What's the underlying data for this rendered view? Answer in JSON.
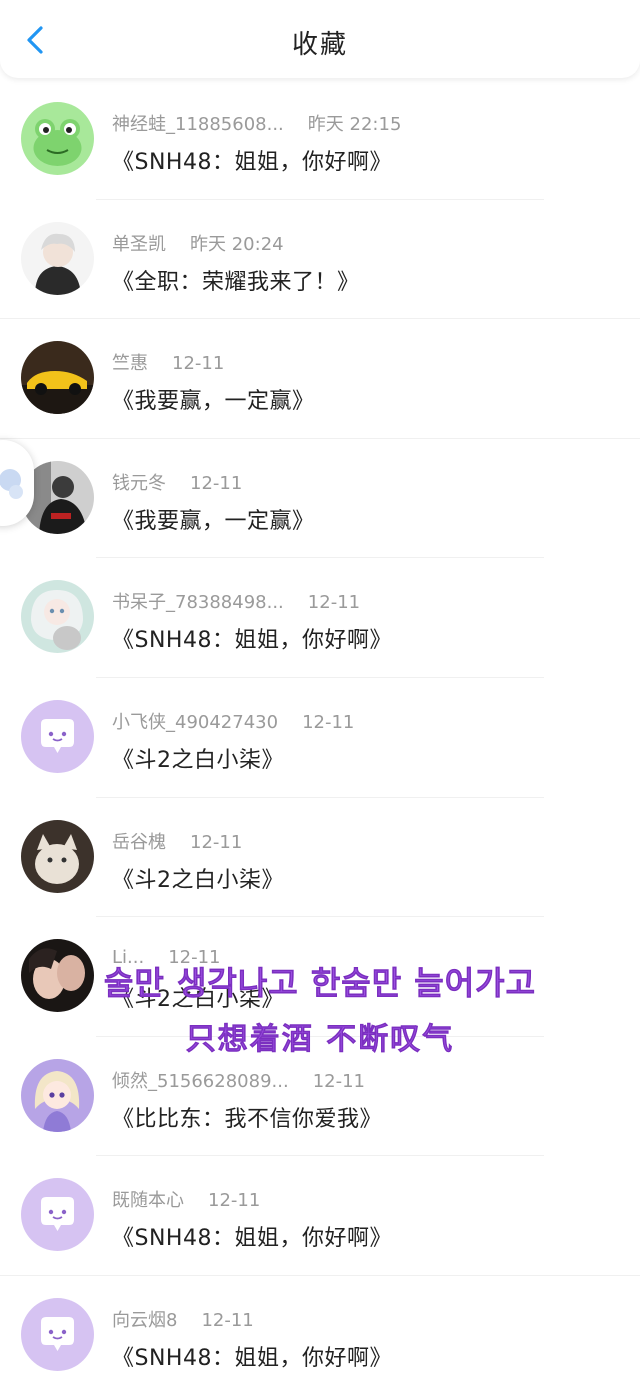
{
  "header": {
    "title": "收藏",
    "back_icon": "chevron-left-icon",
    "accent_color": "#2196f3"
  },
  "items": [
    {
      "username": "神经蛙_11885608...",
      "time": "昨天 22:15",
      "work": "《SNH48：姐姐，你好啊》",
      "avatar": "frog-avatar"
    },
    {
      "username": "单圣凯",
      "time": "昨天 20:24",
      "work": "《全职：荣耀我来了！》",
      "avatar": "anime-boy-avatar"
    },
    {
      "username": "竺惠",
      "time": "12-11",
      "work": "《我要赢，一定赢》",
      "avatar": "sports-car-avatar"
    },
    {
      "username": "钱元冬",
      "time": "12-11",
      "work": "《我要赢，一定赢》",
      "avatar": "person-photo-avatar"
    },
    {
      "username": "书呆子_78388498...",
      "time": "12-11",
      "work": "《SNH48：姐姐，你好啊》",
      "avatar": "doll-with-cat-avatar"
    },
    {
      "username": "小飞侠_490427430",
      "time": "12-11",
      "work": "《斗2之白小柒》",
      "avatar": "default-chat-avatar"
    },
    {
      "username": "岳谷槐",
      "time": "12-11",
      "work": "《斗2之白小柒》",
      "avatar": "kitten-avatar"
    },
    {
      "username": "Li...",
      "time": "12-11",
      "work": "《斗2之白小柒》",
      "avatar": "couple-photo-avatar"
    },
    {
      "username": "倾然_5156628089...",
      "time": "12-11",
      "work": "《比比东：我不信你爱我》",
      "avatar": "cartoon-girl-avatar"
    },
    {
      "username": "既随本心",
      "time": "12-11",
      "work": "《SNH48：姐姐，你好啊》",
      "avatar": "default-chat-avatar"
    },
    {
      "username": "向云烟8",
      "time": "12-11",
      "work": "《SNH48：姐姐，你好啊》",
      "avatar": "default-chat-avatar"
    }
  ],
  "overlay_subtitle": {
    "line1": "술만 생각나고 한숨만 늘어가고",
    "line2": "只想着酒 不断叹气",
    "color": "#9b4fe0"
  },
  "floating_widget": {
    "icon": "floating-assistant-icon"
  }
}
